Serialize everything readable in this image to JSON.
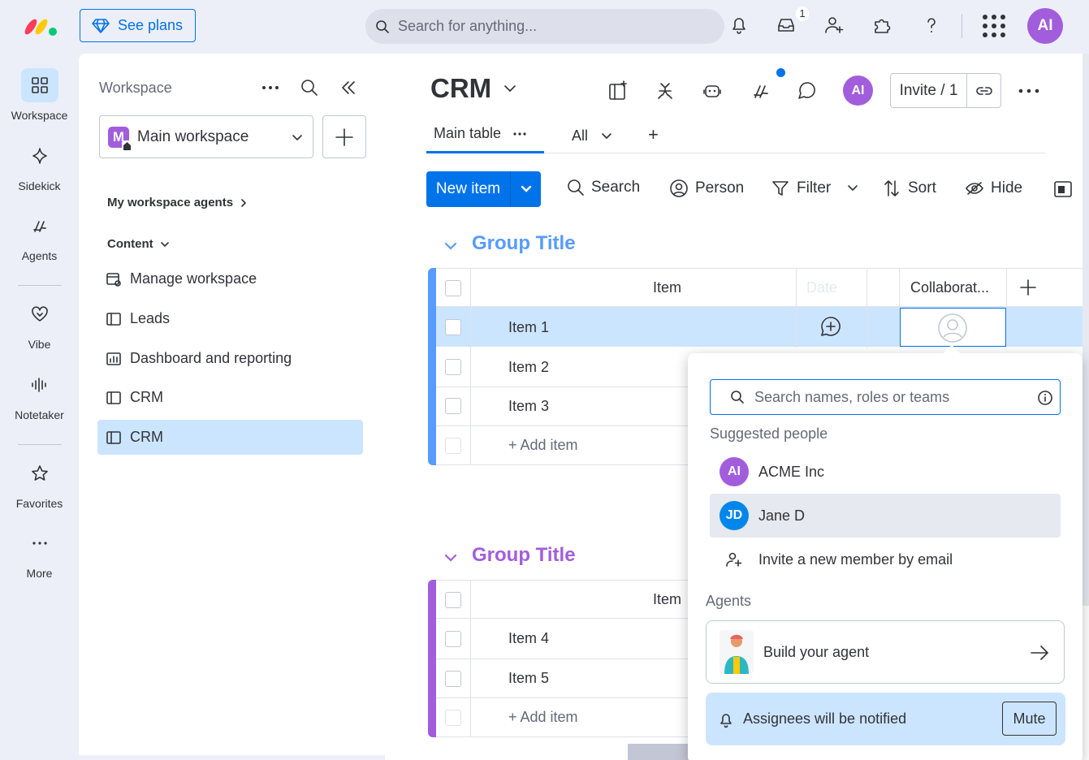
{
  "topbar": {
    "see_plans": "See plans",
    "search_placeholder": "Search for anything...",
    "inbox_badge": "1",
    "user_initials": "AI"
  },
  "rail": {
    "items": [
      {
        "label": "Workspace",
        "icon": "grid-icon"
      },
      {
        "label": "Sidekick",
        "icon": "sparkle-icon"
      },
      {
        "label": "Agents",
        "icon": "agents-icon"
      },
      {
        "label": "Vibe",
        "icon": "heart-icon"
      },
      {
        "label": "Notetaker",
        "icon": "waveform-icon"
      },
      {
        "label": "Favorites",
        "icon": "star-icon"
      },
      {
        "label": "More",
        "icon": "more-icon"
      }
    ]
  },
  "workspace": {
    "title": "Workspace",
    "selected": "Main workspace",
    "selected_letter": "M",
    "agents_link": "My workspace agents",
    "content_label": "Content",
    "nav": [
      {
        "label": "Manage workspace"
      },
      {
        "label": "Leads"
      },
      {
        "label": "Dashboard and reporting"
      },
      {
        "label": "CRM"
      },
      {
        "label": "CRM"
      }
    ]
  },
  "board": {
    "title": "CRM",
    "user_initials": "AI",
    "invite_label": "Invite / 1",
    "tabs": {
      "main": "Main table",
      "all": "All",
      "add": "+"
    },
    "toolbar": {
      "new_item": "New item",
      "search": "Search",
      "person": "Person",
      "filter": "Filter",
      "sort": "Sort",
      "hide": "Hide"
    },
    "groups": [
      {
        "title": "Group Title",
        "color": "#579bfc",
        "col_item": "Item",
        "col_date": "Date",
        "col_collab": "Collaborat...",
        "rows": [
          "Item 1",
          "Item 2",
          "Item 3"
        ],
        "add_item": "+ Add item"
      },
      {
        "title": "Group Title",
        "color": "#a25ddc",
        "col_item": "Item",
        "rows": [
          "Item 4",
          "Item 5"
        ],
        "add_item": "+ Add item"
      }
    ]
  },
  "popup": {
    "search_placeholder": "Search names, roles or teams",
    "suggested_label": "Suggested people",
    "people": [
      {
        "initials": "AI",
        "name": "ACME Inc",
        "color": "#a25ddc"
      },
      {
        "initials": "JD",
        "name": "Jane D",
        "color": "#0086ea"
      }
    ],
    "invite_email": "Invite a new member by email",
    "agents_label": "Agents",
    "build_agent": "Build your agent",
    "notify": "Assignees will be notified",
    "mute": "Mute"
  }
}
